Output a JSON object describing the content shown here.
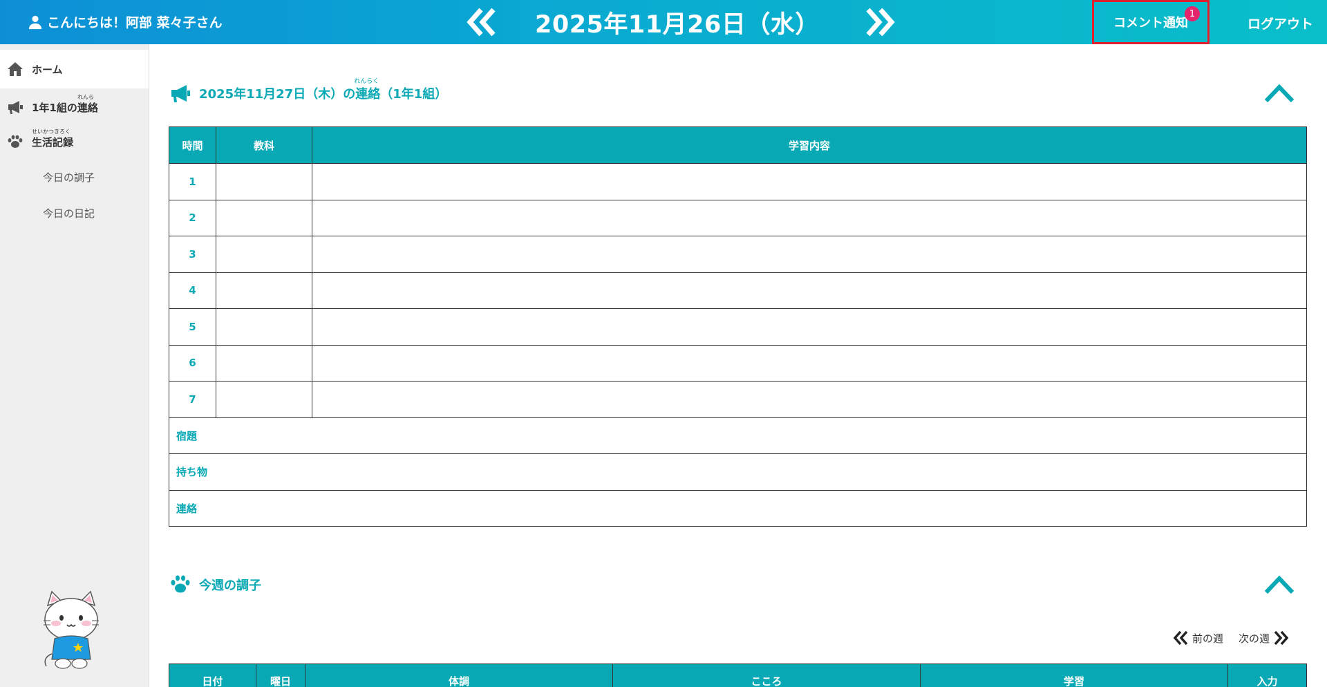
{
  "header": {
    "greeting": "こんにちは！阿部 菜々子さん",
    "date_title": "2025年11月26日（水）",
    "notify_label": "コメント通知",
    "notify_count": "1",
    "logout_label": "ログアウト"
  },
  "sidebar": {
    "home": "ホーム",
    "class_contact": "1年1組の連絡",
    "class_contact_ruby": "れんらく",
    "life_record": "生活記録",
    "life_record_ruby": "せいかつきろく",
    "sub_items": [
      "今日の調子",
      "今日の日記"
    ]
  },
  "contact_section": {
    "title_prefix": "2025年11月27日（木）の",
    "title_word": "連絡",
    "title_ruby": "れんらく",
    "title_suffix": "（1年1組）",
    "columns": [
      "時間",
      "教科",
      "学習内容"
    ],
    "periods": [
      "1",
      "2",
      "3",
      "4",
      "5",
      "6",
      "7"
    ],
    "extra_rows": [
      "宿題",
      "持ち物",
      "連絡"
    ]
  },
  "week_section": {
    "title": "今週の調子",
    "prev_week": "前の週",
    "next_week": "次の週",
    "columns": [
      "日付",
      "曜日",
      "体調",
      "こころ",
      "学習",
      "入力"
    ]
  }
}
